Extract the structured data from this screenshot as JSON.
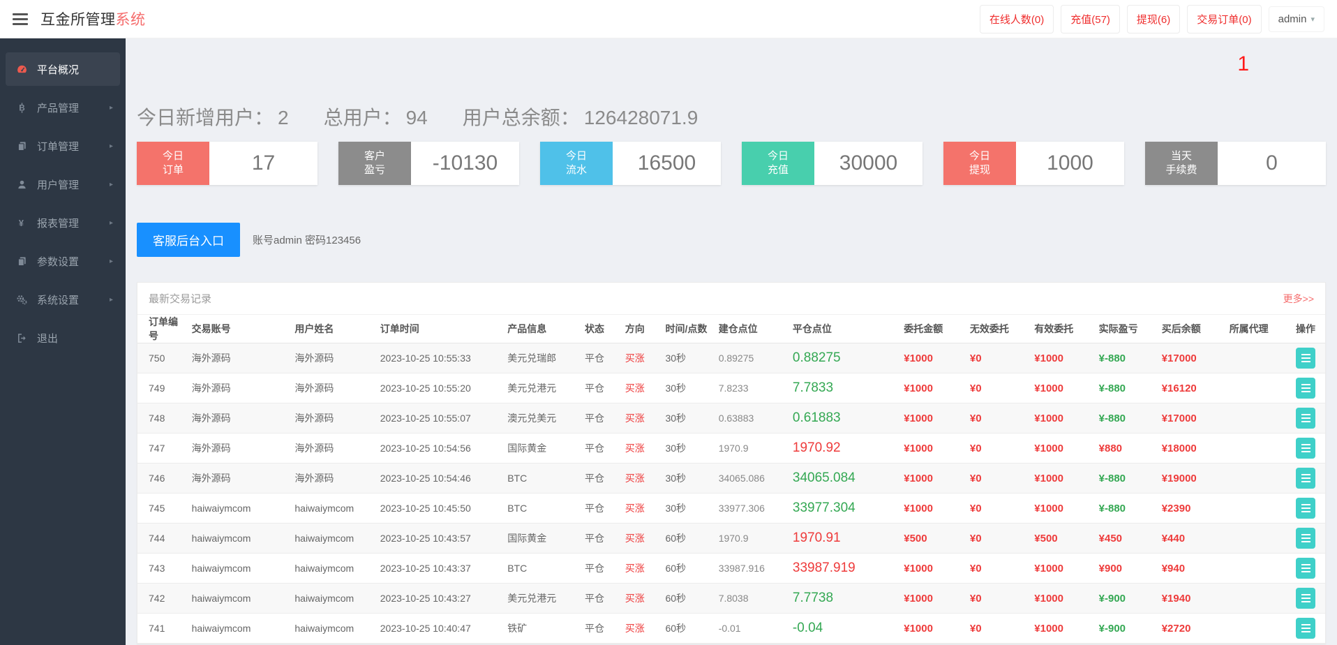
{
  "header": {
    "brand_dark": "互金所管理",
    "brand_red": "系统",
    "nav_buttons": [
      {
        "label": "在线人数(0)"
      },
      {
        "label": "充值(57)"
      },
      {
        "label": "提现(6)"
      },
      {
        "label": "交易订单(0)"
      }
    ],
    "user_menu": "admin",
    "caret": "▾"
  },
  "sidebar": {
    "items": [
      {
        "label": "平台概况",
        "icon": "dashboard-icon",
        "active": true,
        "has_children": false
      },
      {
        "label": "产品管理",
        "icon": "bitcoin-icon",
        "active": false,
        "has_children": true
      },
      {
        "label": "订单管理",
        "icon": "files-icon",
        "active": false,
        "has_children": true
      },
      {
        "label": "用户管理",
        "icon": "user-icon",
        "active": false,
        "has_children": true
      },
      {
        "label": "报表管理",
        "icon": "yen-icon",
        "active": false,
        "has_children": true
      },
      {
        "label": "参数设置",
        "icon": "files-icon",
        "active": false,
        "has_children": true
      },
      {
        "label": "系统设置",
        "icon": "gears-icon",
        "active": false,
        "has_children": true
      },
      {
        "label": "退出",
        "icon": "sign-out-icon",
        "active": false,
        "has_children": false
      }
    ],
    "chevron": "▸"
  },
  "overview": {
    "badge": "1",
    "stats": [
      {
        "label": "今日新增用户：",
        "value": "2"
      },
      {
        "label": "总用户：",
        "value": "94"
      },
      {
        "label": "用户总余额：",
        "value": "126428071.9"
      }
    ],
    "cards": [
      {
        "line1": "今日",
        "line2": "订单",
        "value": "17",
        "color": "#f4736b"
      },
      {
        "line1": "客户",
        "line2": "盈亏",
        "value": "-10130",
        "color": "#8c8c8c"
      },
      {
        "line1": "今日",
        "line2": "流水",
        "value": "16500",
        "color": "#4fc1e9"
      },
      {
        "line1": "今日",
        "line2": "充值",
        "value": "30000",
        "color": "#48cfad"
      },
      {
        "line1": "今日",
        "line2": "提现",
        "value": "1000",
        "color": "#f4736b"
      },
      {
        "line1": "当天",
        "line2": "手续费",
        "value": "0",
        "color": "#8c8c8c"
      }
    ],
    "service": {
      "button": "客服后台入口",
      "note": "账号admin 密码123456"
    }
  },
  "table": {
    "title": "最新交易记录",
    "more_link": "更多>>",
    "columns": [
      "订单编号",
      "交易账号",
      "用户姓名",
      "订单时间",
      "产品信息",
      "状态",
      "方向",
      "时间/点数",
      "建仓点位",
      "平仓点位",
      "委托金额",
      "无效委托",
      "有效委托",
      "实际盈亏",
      "买后余额",
      "所属代理",
      "操作"
    ],
    "rows": [
      {
        "id": "750",
        "account": "海外源码",
        "name": "海外源码",
        "time": "2023-10-25 10:55:33",
        "product": "美元兑瑞郎",
        "status": "平仓",
        "direction": "买涨",
        "period": "30秒",
        "open": "0.89275",
        "close": "0.88275",
        "close_color": "green",
        "amount": "¥1000",
        "invalid": "¥0",
        "valid": "¥1000",
        "profit": "¥-880",
        "profit_color": "green",
        "balance": "¥17000",
        "agent": ""
      },
      {
        "id": "749",
        "account": "海外源码",
        "name": "海外源码",
        "time": "2023-10-25 10:55:20",
        "product": "美元兑港元",
        "status": "平仓",
        "direction": "买涨",
        "period": "30秒",
        "open": "7.8233",
        "close": "7.7833",
        "close_color": "green",
        "amount": "¥1000",
        "invalid": "¥0",
        "valid": "¥1000",
        "profit": "¥-880",
        "profit_color": "green",
        "balance": "¥16120",
        "agent": ""
      },
      {
        "id": "748",
        "account": "海外源码",
        "name": "海外源码",
        "time": "2023-10-25 10:55:07",
        "product": "澳元兑美元",
        "status": "平仓",
        "direction": "买涨",
        "period": "30秒",
        "open": "0.63883",
        "close": "0.61883",
        "close_color": "green",
        "amount": "¥1000",
        "invalid": "¥0",
        "valid": "¥1000",
        "profit": "¥-880",
        "profit_color": "green",
        "balance": "¥17000",
        "agent": ""
      },
      {
        "id": "747",
        "account": "海外源码",
        "name": "海外源码",
        "time": "2023-10-25 10:54:56",
        "product": "国际黄金",
        "status": "平仓",
        "direction": "买涨",
        "period": "30秒",
        "open": "1970.9",
        "close": "1970.92",
        "close_color": "red",
        "amount": "¥1000",
        "invalid": "¥0",
        "valid": "¥1000",
        "profit": "¥880",
        "profit_color": "red",
        "balance": "¥18000",
        "agent": ""
      },
      {
        "id": "746",
        "account": "海外源码",
        "name": "海外源码",
        "time": "2023-10-25 10:54:46",
        "product": "BTC",
        "status": "平仓",
        "direction": "买涨",
        "period": "30秒",
        "open": "34065.086",
        "close": "34065.084",
        "close_color": "green",
        "amount": "¥1000",
        "invalid": "¥0",
        "valid": "¥1000",
        "profit": "¥-880",
        "profit_color": "green",
        "balance": "¥19000",
        "agent": ""
      },
      {
        "id": "745",
        "account": "haiwaiymcom",
        "name": "haiwaiymcom",
        "time": "2023-10-25 10:45:50",
        "product": "BTC",
        "status": "平仓",
        "direction": "买涨",
        "period": "30秒",
        "open": "33977.306",
        "close": "33977.304",
        "close_color": "green",
        "amount": "¥1000",
        "invalid": "¥0",
        "valid": "¥1000",
        "profit": "¥-880",
        "profit_color": "green",
        "balance": "¥2390",
        "agent": ""
      },
      {
        "id": "744",
        "account": "haiwaiymcom",
        "name": "haiwaiymcom",
        "time": "2023-10-25 10:43:57",
        "product": "国际黄金",
        "status": "平仓",
        "direction": "买涨",
        "period": "60秒",
        "open": "1970.9",
        "close": "1970.91",
        "close_color": "red",
        "amount": "¥500",
        "invalid": "¥0",
        "valid": "¥500",
        "profit": "¥450",
        "profit_color": "red",
        "balance": "¥440",
        "agent": ""
      },
      {
        "id": "743",
        "account": "haiwaiymcom",
        "name": "haiwaiymcom",
        "time": "2023-10-25 10:43:37",
        "product": "BTC",
        "status": "平仓",
        "direction": "买涨",
        "period": "60秒",
        "open": "33987.916",
        "close": "33987.919",
        "close_color": "red",
        "amount": "¥1000",
        "invalid": "¥0",
        "valid": "¥1000",
        "profit": "¥900",
        "profit_color": "red",
        "balance": "¥940",
        "agent": ""
      },
      {
        "id": "742",
        "account": "haiwaiymcom",
        "name": "haiwaiymcom",
        "time": "2023-10-25 10:43:27",
        "product": "美元兑港元",
        "status": "平仓",
        "direction": "买涨",
        "period": "60秒",
        "open": "7.8038",
        "close": "7.7738",
        "close_color": "green",
        "amount": "¥1000",
        "invalid": "¥0",
        "valid": "¥1000",
        "profit": "¥-900",
        "profit_color": "green",
        "balance": "¥1940",
        "agent": ""
      },
      {
        "id": "741",
        "account": "haiwaiymcom",
        "name": "haiwaiymcom",
        "time": "2023-10-25 10:40:47",
        "product": "铁矿",
        "status": "平仓",
        "direction": "买涨",
        "period": "60秒",
        "open": "-0.01",
        "close": "-0.04",
        "close_color": "green",
        "amount": "¥1000",
        "invalid": "¥0",
        "valid": "¥1000",
        "profit": "¥-900",
        "profit_color": "green",
        "balance": "¥2720",
        "agent": ""
      }
    ]
  },
  "colors": {
    "up_red": "#ee3b3b",
    "down_green": "#34a853",
    "link_blue": "#1890ff",
    "op_teal": "#3fd0c9",
    "sidebar_bg": "#2d3744",
    "brand_red": "#f56c6c"
  }
}
